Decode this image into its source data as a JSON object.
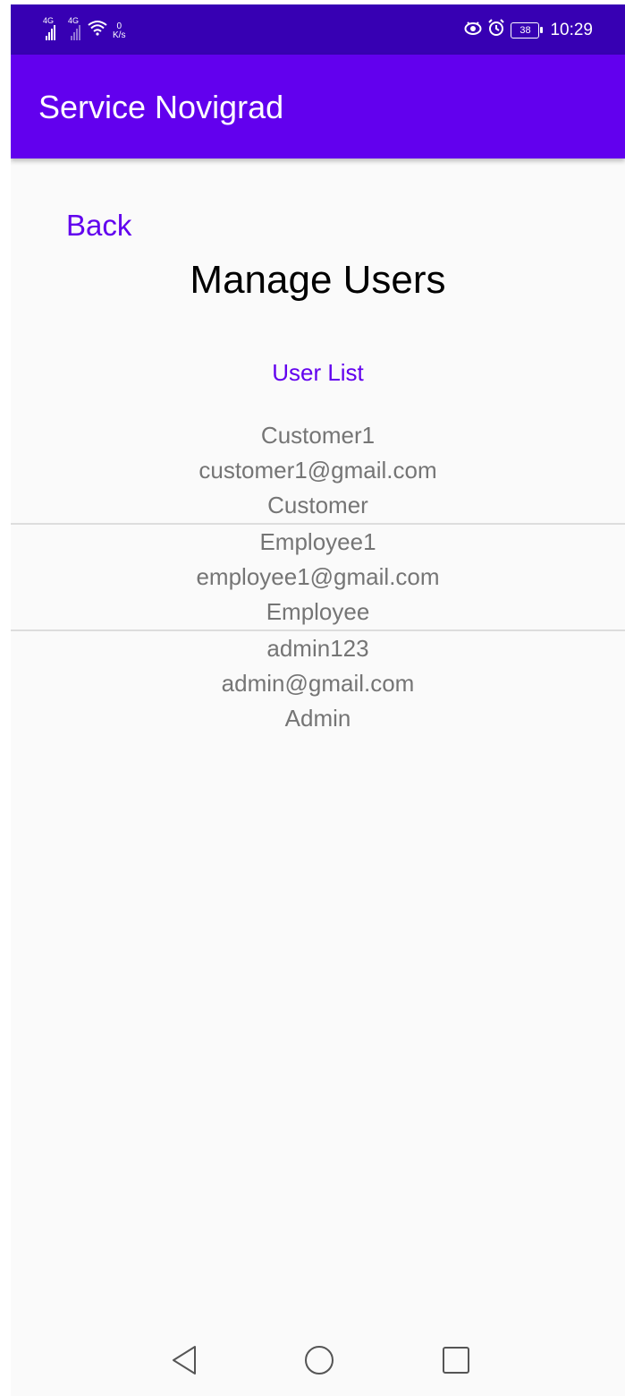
{
  "status_bar": {
    "net1": "4G",
    "net2": "4G",
    "speed_value": "0",
    "speed_unit": "K/s",
    "battery": "38",
    "time": "10:29",
    "icons": [
      "signal-icon",
      "signal-icon",
      "wifi-icon",
      "eye-icon",
      "alarm-icon",
      "battery-icon"
    ]
  },
  "app_bar": {
    "title": "Service Novigrad"
  },
  "main": {
    "back_label": "Back",
    "title": "Manage Users",
    "list_heading": "User List",
    "users": [
      {
        "name": "Customer1",
        "email": "customer1@gmail.com",
        "role": "Customer"
      },
      {
        "name": "Employee1",
        "email": "employee1@gmail.com",
        "role": "Employee"
      },
      {
        "name": "admin123",
        "email": "admin@gmail.com",
        "role": "Admin"
      }
    ]
  },
  "nav_bar": {
    "icons": [
      "back-icon",
      "home-icon",
      "recents-icon"
    ]
  },
  "colors": {
    "status_bar": "#3700b3",
    "primary": "#6200ee",
    "list_text": "#757575",
    "background": "#fafafa"
  }
}
